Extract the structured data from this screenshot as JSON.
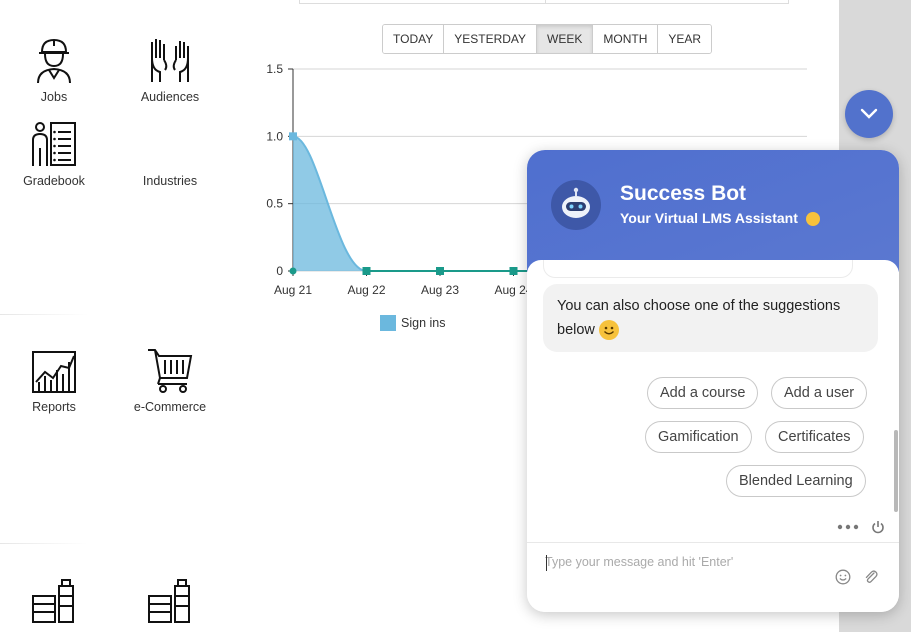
{
  "tiles": [
    {
      "label": "Jobs",
      "icon": "worker-icon"
    },
    {
      "label": "Audiences",
      "icon": "raised-hands-icon"
    },
    {
      "label": "Gradebook",
      "icon": "gradebook-icon"
    },
    {
      "label": "Industries",
      "icon": "industries-icon"
    },
    {
      "label": "Reports",
      "icon": "reports-chart-icon"
    },
    {
      "label": "e-Commerce",
      "icon": "shopping-cart-icon"
    }
  ],
  "periods": [
    "TODAY",
    "YESTERDAY",
    "WEEK",
    "MONTH",
    "YEAR"
  ],
  "active_period": "WEEK",
  "chart_data": {
    "type": "area",
    "x": [
      "Aug 21",
      "Aug 22",
      "Aug 23",
      "Aug 24"
    ],
    "series": [
      {
        "name": "Sign ins",
        "values": [
          1,
          0,
          0,
          0
        ]
      }
    ],
    "ylim": [
      0,
      1.5
    ],
    "yticks": [
      "0",
      "0.5",
      "1.0",
      "1.5"
    ],
    "grid": true,
    "legend": "bottom",
    "color": "#6bb8de",
    "line_color": "#1a9a8a"
  },
  "chat": {
    "bot_name": "Success Bot",
    "bot_subtitle": "Your Virtual LMS Assistant",
    "message": "You can also choose one of the suggestions below",
    "suggestions": [
      "Add a course",
      "Add a user",
      "Gamification",
      "Certificates",
      "Blended Learning"
    ],
    "input_placeholder": "Type your message and hit 'Enter'",
    "header_color": "#5272cc"
  }
}
